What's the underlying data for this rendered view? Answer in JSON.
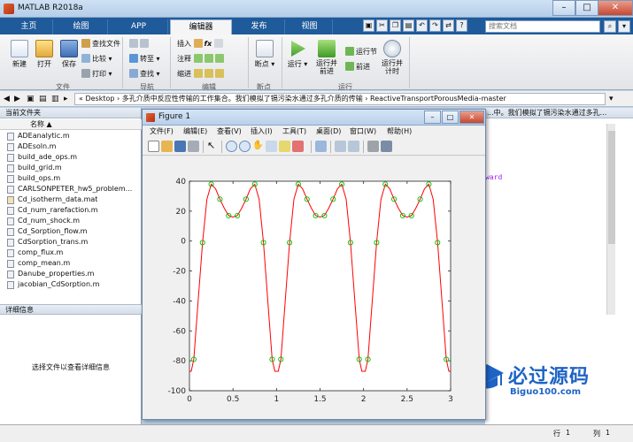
{
  "window": {
    "title": "MATLAB R2018a"
  },
  "tabs": [
    {
      "label": "主页"
    },
    {
      "label": "绘图"
    },
    {
      "label": "APP"
    },
    {
      "label": "编辑器"
    },
    {
      "label": "发布"
    },
    {
      "label": "视图"
    }
  ],
  "search": {
    "placeholder": "搜索文档"
  },
  "ribbon": {
    "file_group": {
      "label": "文件",
      "new": "新建",
      "open": "打开",
      "save": "保存",
      "find_files": "查找文件",
      "compare": "比较",
      "print": "打印"
    },
    "nav_group": {
      "label": "导航",
      "goto": "转至",
      "find": "查找"
    },
    "edit_group": {
      "label": "编辑",
      "insert": "插入",
      "comment": "注释",
      "indent": "缩进"
    },
    "breakpoint_group": {
      "label": "断点",
      "breakpoints": "断点"
    },
    "run_group": {
      "label": "运行",
      "run": "运行",
      "run_advance": "运行并前进",
      "run_section": "运行节",
      "advance": "前进",
      "run_time": "运行并计时"
    }
  },
  "address": {
    "path": "« Desktop › 多孔介质中反应性传输的工作集合。我们模拟了镉污染水通过多孔介质的传输 › ReactiveTransportPorousMedia-master"
  },
  "left_panel": {
    "title": "当前文件夹",
    "column": "名称",
    "files": [
      "ADEanalytic.m",
      "ADEsoln.m",
      "build_ade_ops.m",
      "build_grid.m",
      "build_ops.m",
      "CARLSONPETER_hw5_problem...",
      "Cd_isotherm_data.mat",
      "Cd_num_rarefaction.m",
      "Cd_num_shock.m",
      "Cd_Sorption_flow.m",
      "CdSorption_trans.m",
      "comp_flux.m",
      "comp_mean.m",
      "Danube_properties.m",
      "jacobian_CdSorption.m"
    ],
    "details_title": "详细信息",
    "details_msg": "选择文件以查看详细信息"
  },
  "right_panel": {
    "title_fragment": "...中。我们模拟了镉污染水通过多孔...",
    "code_fragment": "ward"
  },
  "status": {
    "row_label": "行",
    "row": "1",
    "col_label": "列",
    "col": "1"
  },
  "figure": {
    "title": "Figure 1",
    "menus": [
      "文件(F)",
      "编辑(E)",
      "查看(V)",
      "插入(I)",
      "工具(T)",
      "桌面(D)",
      "窗口(W)",
      "帮助(H)"
    ]
  },
  "chart_data": {
    "type": "line",
    "xlim": [
      0,
      3
    ],
    "ylim": [
      -100,
      40
    ],
    "xticks": [
      "0",
      "0.5",
      "1",
      "1.5",
      "2",
      "2.5",
      "3"
    ],
    "yticks": [
      "40",
      "20",
      "0",
      "-20",
      "-40",
      "-60",
      "-80",
      "-100"
    ],
    "grid": false,
    "series": [
      {
        "style": "line",
        "color": "#ff0000",
        "x": [
          0,
          0.02,
          0.05,
          0.1,
          0.15,
          0.2,
          0.25,
          0.3,
          0.35,
          0.4,
          0.45,
          0.5,
          0.55,
          0.6,
          0.65,
          0.7,
          0.75,
          0.8,
          0.85,
          0.9,
          0.95,
          0.98,
          1.0,
          1.02,
          1.05,
          1.1,
          1.15,
          1.2,
          1.25,
          1.3,
          1.35,
          1.4,
          1.45,
          1.5,
          1.55,
          1.6,
          1.65,
          1.7,
          1.75,
          1.8,
          1.85,
          1.9,
          1.95,
          1.98,
          2.0,
          2.02,
          2.05,
          2.1,
          2.15,
          2.2,
          2.25,
          2.3,
          2.35,
          2.4,
          2.45,
          2.5,
          2.55,
          2.6,
          2.65,
          2.7,
          2.75,
          2.8,
          2.85,
          2.9,
          2.95,
          2.98,
          3.0
        ],
        "y": [
          -87,
          -87,
          -79,
          -40,
          -1,
          28,
          38,
          35,
          28,
          22,
          17,
          16,
          17,
          22,
          28,
          35,
          38,
          28,
          -1,
          -40,
          -79,
          -87,
          -87,
          -87,
          -79,
          -40,
          -1,
          28,
          38,
          35,
          28,
          22,
          17,
          16,
          17,
          22,
          28,
          35,
          38,
          28,
          -1,
          -40,
          -79,
          -87,
          -87,
          -87,
          -79,
          -40,
          -1,
          28,
          38,
          35,
          28,
          22,
          17,
          16,
          17,
          22,
          28,
          35,
          38,
          28,
          -1,
          -40,
          -79,
          -87,
          -87
        ]
      },
      {
        "style": "markers",
        "marker": "circle",
        "color": "#00c000",
        "x": [
          0.05,
          0.15,
          0.25,
          0.35,
          0.45,
          0.55,
          0.65,
          0.75,
          0.85,
          0.95,
          1.05,
          1.15,
          1.25,
          1.35,
          1.45,
          1.55,
          1.65,
          1.75,
          1.85,
          1.95,
          2.05,
          2.15,
          2.25,
          2.35,
          2.45,
          2.55,
          2.65,
          2.75,
          2.85,
          2.95
        ],
        "y": [
          -79,
          -1,
          38,
          28,
          17,
          17,
          28,
          38,
          -1,
          -79,
          -79,
          -1,
          38,
          28,
          17,
          17,
          28,
          38,
          -1,
          -79,
          -79,
          -1,
          38,
          28,
          17,
          17,
          28,
          38,
          -1,
          -79
        ]
      }
    ]
  },
  "watermark": {
    "title": "必过源码",
    "sub": "Biguo100.com"
  }
}
